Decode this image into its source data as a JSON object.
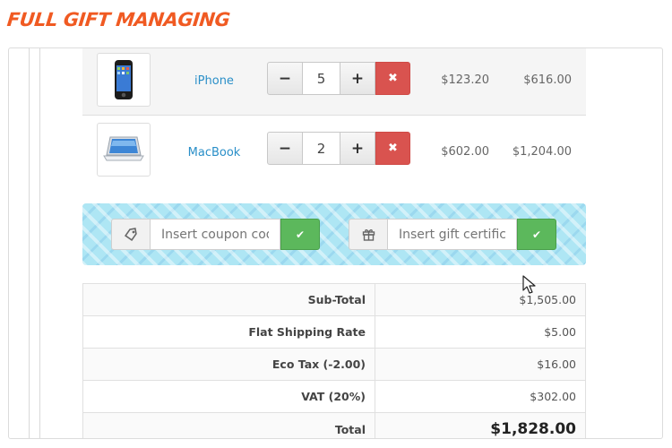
{
  "banner": {
    "title": "FULL GIFT MANAGING"
  },
  "cart": {
    "items": [
      {
        "name": "iPhone",
        "qty": "5",
        "price": "$123.20",
        "total": "$616.00",
        "thumb_icon": "iphone-image"
      },
      {
        "name": "MacBook",
        "qty": "2",
        "price": "$602.00",
        "total": "$1,204.00",
        "thumb_icon": "macbook-image"
      }
    ],
    "minus_label": "−",
    "plus_label": "+",
    "remove_label": "✖"
  },
  "coupon": {
    "placeholder": "Insert coupon code",
    "icon": "tag-icon",
    "apply_label": "✔"
  },
  "gift": {
    "placeholder": "Insert gift certificate",
    "icon": "gift-icon",
    "apply_label": "✔"
  },
  "totals": [
    {
      "label": "Sub-Total",
      "value": "$1,505.00"
    },
    {
      "label": "Flat Shipping Rate",
      "value": "$5.00"
    },
    {
      "label": "Eco Tax (-2.00)",
      "value": "$16.00"
    },
    {
      "label": "VAT (20%)",
      "value": "$302.00"
    },
    {
      "label": "Total",
      "value": "$1,828.00"
    }
  ],
  "colors": {
    "accent_orange": "#f05a22",
    "link_blue": "#2a8fc8",
    "remove_red": "#d9534f",
    "apply_green": "#5cb85c",
    "coupon_bar": "#aee6f4"
  }
}
